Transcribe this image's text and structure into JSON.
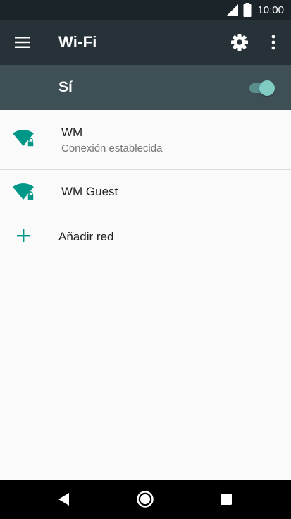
{
  "status_bar": {
    "time": "10:00",
    "icons": [
      "cell-signal-icon",
      "battery-icon"
    ]
  },
  "app_bar": {
    "title": "Wi-Fi",
    "icons": [
      "menu-icon",
      "gear-icon",
      "more-vert-icon"
    ]
  },
  "master_switch": {
    "label": "Sí",
    "enabled": true
  },
  "networks": [
    {
      "name": "WM",
      "status": "Conexión establecida",
      "icon": "wifi-lock-icon"
    },
    {
      "name": "WM Guest",
      "icon": "wifi-lock-icon"
    }
  ],
  "add_network": {
    "label": "Añadir red",
    "icon": "plus-icon"
  },
  "nav_bar": {
    "icons": [
      "back-icon",
      "home-icon",
      "recents-icon"
    ]
  },
  "colors": {
    "status_bar": "#1b2428",
    "app_bar": "#263238",
    "switch_bar": "#3e4f56",
    "accent": "#009688",
    "toggle_thumb": "#80cbc4",
    "background": "#fafafa"
  }
}
